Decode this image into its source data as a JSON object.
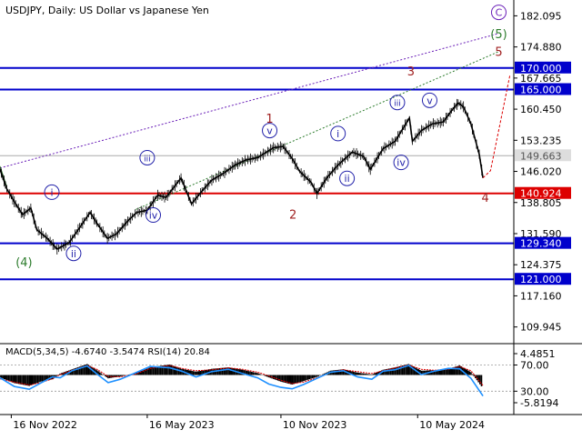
{
  "header": {
    "text": "USDJPY, Daily:  US Dollar vs Japanese Yen"
  },
  "colors": {
    "blue_level": "#0000cc",
    "red_level": "#dd0000",
    "grey_level": "#aaaaaa",
    "price": "#000000",
    "purple": "#6a1fb8",
    "green": "#2e7d2e",
    "red_wave": "#a02020",
    "blue_wave": "#2222aa",
    "macd_hist": "#000000",
    "macd_signal": "#dd0000",
    "rsi": "#1e90ff",
    "axis_label_bg": "#0000cc",
    "axis_label_text": "#ffffff"
  },
  "chart_data": [
    {
      "type": "line",
      "id": "main",
      "title": "USDJPY, Daily:  US Dollar vs Japanese Yen",
      "xlim": [
        "2022-11-01",
        "2024-09-15"
      ],
      "ylim": [
        106.5,
        184.5
      ],
      "x_ticks": [
        {
          "date": "2022-11-16",
          "label": "16 Nov 2022"
        },
        {
          "date": "2023-05-16",
          "label": "16 May 2023"
        },
        {
          "date": "2023-11-10",
          "label": "10 Nov 2023"
        },
        {
          "date": "2024-05-10",
          "label": "10 May 2024"
        }
      ],
      "y_ticks": [
        {
          "value": 182.095,
          "label": "182.095"
        },
        {
          "value": 174.88,
          "label": "174.880"
        },
        {
          "value": 167.665,
          "label": "167.665"
        },
        {
          "value": 160.45,
          "label": "160.450"
        },
        {
          "value": 153.235,
          "label": "153.235"
        },
        {
          "value": 146.02,
          "label": "146.020"
        },
        {
          "value": 138.805,
          "label": "138.805"
        },
        {
          "value": 131.59,
          "label": "131.590"
        },
        {
          "value": 124.375,
          "label": "124.375"
        },
        {
          "value": 117.16,
          "label": "117.160"
        },
        {
          "value": 109.945,
          "label": "109.945"
        }
      ],
      "levels": [
        {
          "value": 170.0,
          "label": "170.000",
          "color": "#0000cc"
        },
        {
          "value": 165.0,
          "label": "165.000",
          "color": "#0000cc"
        },
        {
          "value": 149.663,
          "label": "149.663",
          "color": "#aaaaaa"
        },
        {
          "value": 140.924,
          "label": "140.924",
          "color": "#dd0000"
        },
        {
          "value": 129.34,
          "label": "129.340",
          "color": "#0000cc"
        },
        {
          "value": 121.0,
          "label": "121.000",
          "color": "#0000cc"
        }
      ],
      "price_series": {
        "name": "",
        "x": [
          "2022-11-01",
          "2022-11-10",
          "2022-11-20",
          "2022-12-01",
          "2022-12-12",
          "2022-12-20",
          "2023-01-03",
          "2023-01-16",
          "2023-02-01",
          "2023-02-15",
          "2023-03-01",
          "2023-03-10",
          "2023-03-24",
          "2023-04-05",
          "2023-04-20",
          "2023-05-02",
          "2023-05-16",
          "2023-05-30",
          "2023-06-10",
          "2023-06-30",
          "2023-07-14",
          "2023-07-28",
          "2023-08-10",
          "2023-08-25",
          "2023-09-10",
          "2023-09-25",
          "2023-10-10",
          "2023-10-31",
          "2023-11-13",
          "2023-11-25",
          "2023-12-05",
          "2023-12-20",
          "2023-12-28",
          "2024-01-10",
          "2024-01-25",
          "2024-02-13",
          "2024-02-28",
          "2024-03-08",
          "2024-03-25",
          "2024-04-10",
          "2024-04-29",
          "2024-05-03",
          "2024-05-15",
          "2024-05-29",
          "2024-06-13",
          "2024-06-26",
          "2024-07-03",
          "2024-07-10",
          "2024-07-20",
          "2024-07-31",
          "2024-08-05"
        ],
        "y": [
          146.5,
          142.0,
          139.0,
          136.0,
          137.5,
          132.5,
          130.5,
          128.0,
          129.5,
          133.0,
          136.5,
          134.0,
          130.5,
          131.5,
          134.5,
          136.5,
          137.0,
          140.5,
          140.0,
          144.5,
          138.5,
          141.5,
          144.0,
          145.5,
          147.5,
          148.7,
          149.2,
          151.5,
          151.8,
          149.0,
          146.0,
          143.5,
          140.9,
          144.5,
          147.5,
          150.5,
          149.5,
          146.5,
          151.3,
          153.0,
          158.4,
          153.0,
          155.5,
          157.0,
          157.5,
          160.5,
          161.9,
          161.0,
          157.0,
          150.0,
          144.5
        ]
      },
      "forecast_path": {
        "x": [
          "2024-08-05",
          "2024-08-15",
          "2024-09-10"
        ],
        "y": [
          144.5,
          146.2,
          168.5
        ]
      },
      "channel_upper": {
        "x": [
          "2022-11-01",
          "2024-08-26"
        ],
        "y": [
          146.8,
          178.0
        ]
      },
      "channel_lower": {
        "x": [
          "2022-11-01",
          "2024-08-26"
        ],
        "y": [
          147.2,
          148.0
        ]
      },
      "trend_line_green": {
        "x": [
          "2023-05-01",
          "2024-08-26"
        ],
        "y": [
          137.2,
          173.8
        ]
      },
      "wave_labels": [
        {
          "text": "C",
          "style": "purple-circle",
          "x": "2024-08-26",
          "y": 182.9
        },
        {
          "text": "(5)",
          "style": "green",
          "x": "2024-08-26",
          "y": 178.0
        },
        {
          "text": "5",
          "style": "red",
          "x": "2024-08-26",
          "y": 173.9
        },
        {
          "text": "3",
          "style": "red",
          "x": "2024-05-01",
          "y": 169.3
        },
        {
          "text": "v",
          "style": "blue-circle",
          "x": "2024-05-26",
          "y": 162.5
        },
        {
          "text": "iii",
          "style": "blue-circle",
          "x": "2024-04-13",
          "y": 162.0
        },
        {
          "text": "iv",
          "style": "blue-circle",
          "x": "2024-04-18",
          "y": 148.1
        },
        {
          "text": "4",
          "style": "red",
          "x": "2024-08-08",
          "y": 140.0
        },
        {
          "text": "1",
          "style": "red",
          "x": "2023-10-26",
          "y": 158.4
        },
        {
          "text": "v",
          "style": "blue-circle",
          "x": "2023-10-26",
          "y": 155.5
        },
        {
          "text": "i",
          "style": "blue-circle",
          "x": "2024-01-25",
          "y": 154.8
        },
        {
          "text": "ii",
          "style": "blue-circle",
          "x": "2024-02-06",
          "y": 144.4
        },
        {
          "text": "2",
          "style": "red",
          "x": "2023-11-26",
          "y": 136.1
        },
        {
          "text": "iii",
          "style": "blue-circle",
          "x": "2023-05-16",
          "y": 149.2
        },
        {
          "text": "iv",
          "style": "blue-circle",
          "x": "2023-05-24",
          "y": 135.9
        },
        {
          "text": "i",
          "style": "blue-circle",
          "x": "2023-01-09",
          "y": 141.2
        },
        {
          "text": "ii",
          "style": "blue-circle",
          "x": "2023-02-07",
          "y": 127.0
        },
        {
          "text": "(4)",
          "style": "green",
          "x": "2022-12-03",
          "y": 125.1
        }
      ]
    },
    {
      "type": "line",
      "id": "indicator",
      "title": "MACD(5,34,5) -4.6740 -3.5474 RSI(14) 20.84",
      "ylim": [
        -8.3,
        6.2
      ],
      "y_ticks": [
        {
          "value": 4.4851,
          "label": "4.4851"
        },
        {
          "value": 2.1,
          "label": "70.00"
        },
        {
          "value": -3.4,
          "label": "30.00"
        },
        {
          "value": -5.8194,
          "label": "-5.8194"
        }
      ],
      "reference_lines": [
        2.1,
        -3.4
      ],
      "macd_histogram": {
        "x": [
          "2022-11-01",
          "2022-11-20",
          "2022-12-10",
          "2022-12-25",
          "2023-01-10",
          "2023-01-20",
          "2023-02-05",
          "2023-02-25",
          "2023-03-10",
          "2023-03-25",
          "2023-04-10",
          "2023-05-01",
          "2023-05-20",
          "2023-06-15",
          "2023-07-01",
          "2023-07-20",
          "2023-08-10",
          "2023-09-01",
          "2023-09-20",
          "2023-10-10",
          "2023-10-25",
          "2023-11-10",
          "2023-11-25",
          "2023-12-10",
          "2023-12-28",
          "2024-01-15",
          "2024-02-01",
          "2024-02-20",
          "2024-03-10",
          "2024-03-25",
          "2024-04-10",
          "2024-04-28",
          "2024-05-15",
          "2024-06-01",
          "2024-06-20",
          "2024-07-05",
          "2024-07-20",
          "2024-08-05"
        ],
        "values": [
          -0.5,
          -1.7,
          -2.3,
          -1.4,
          -0.9,
          0.3,
          1.2,
          2.3,
          1.0,
          -0.7,
          -0.3,
          0.4,
          1.6,
          2.2,
          1.3,
          0.7,
          1.3,
          1.6,
          1.1,
          0.4,
          -0.5,
          -1.4,
          -2.0,
          -1.3,
          -0.4,
          0.9,
          1.2,
          0.5,
          0.1,
          1.1,
          1.6,
          2.3,
          0.9,
          1.0,
          1.3,
          2.0,
          0.6,
          -2.8
        ]
      },
      "macd_signal_values": [
        -0.8,
        -1.5,
        -2.1,
        -1.6,
        -0.8,
        0.1,
        1.0,
        2.0,
        1.2,
        -0.3,
        -0.4,
        0.2,
        1.4,
        2.0,
        1.4,
        0.9,
        1.1,
        1.5,
        1.2,
        0.6,
        -0.2,
        -1.1,
        -1.8,
        -1.5,
        -0.6,
        0.6,
        1.1,
        0.7,
        0.3,
        0.9,
        1.5,
        2.1,
        1.2,
        1.0,
        1.2,
        1.8,
        0.9,
        -2.2
      ],
      "rsi_values": [
        -0.6,
        -2.4,
        -3.0,
        -1.7,
        -0.4,
        -0.6,
        0.9,
        1.9,
        0.2,
        -1.6,
        -0.9,
        0.5,
        1.8,
        1.5,
        0.8,
        -0.4,
        0.7,
        1.2,
        0.3,
        -0.6,
        -1.9,
        -2.6,
        -2.9,
        -2.0,
        -0.7,
        0.6,
        0.9,
        -0.4,
        -0.9,
        0.8,
        1.1,
        2.0,
        0.1,
        0.8,
        1.4,
        1.3,
        -0.7,
        -4.4
      ]
    }
  ]
}
